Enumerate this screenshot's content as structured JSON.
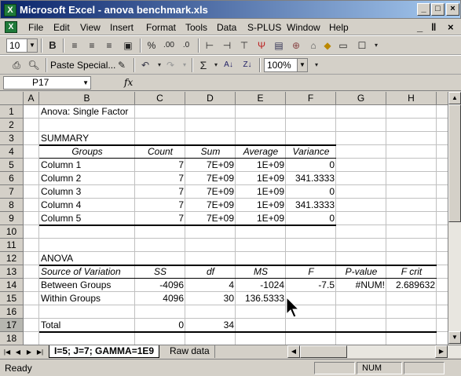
{
  "window": {
    "title": "Microsoft Excel - anova benchmark.xls",
    "minimize": "_",
    "maximize": "□",
    "close": "×"
  },
  "menu": {
    "items": [
      "File",
      "Edit",
      "View",
      "Insert",
      "Format",
      "Tools",
      "Data",
      "S-PLUS",
      "Window",
      "Help"
    ],
    "doc_controls": [
      "_",
      "ǁ",
      "×"
    ]
  },
  "toolbar1": {
    "font_size": "10",
    "bold": "B"
  },
  "toolbar2": {
    "paste_special": "Paste Special...",
    "zoom": "100%",
    "sigma": "Σ"
  },
  "formula_bar": {
    "name_box": "P17",
    "fx": "fx",
    "content": ""
  },
  "grid": {
    "columns": [
      "A",
      "B",
      "C",
      "D",
      "E",
      "F",
      "G",
      "H"
    ],
    "rows": [
      "1",
      "2",
      "3",
      "4",
      "5",
      "6",
      "7",
      "8",
      "9",
      "10",
      "11",
      "12",
      "13",
      "14",
      "15",
      "16",
      "17",
      "18"
    ],
    "selected_row": "17",
    "cells": {
      "B1": "Anova: Single Factor",
      "B3": "SUMMARY",
      "summary_headers": [
        "Groups",
        "Count",
        "Sum",
        "Average",
        "Variance"
      ],
      "summary_rows": [
        [
          "Column 1",
          "7",
          "7E+09",
          "1E+09",
          "0"
        ],
        [
          "Column 2",
          "7",
          "7E+09",
          "1E+09",
          "341.3333"
        ],
        [
          "Column 3",
          "7",
          "7E+09",
          "1E+09",
          "0"
        ],
        [
          "Column 4",
          "7",
          "7E+09",
          "1E+09",
          "341.3333"
        ],
        [
          "Column 5",
          "7",
          "7E+09",
          "1E+09",
          "0"
        ]
      ],
      "B12": "ANOVA",
      "anova_headers": [
        "Source of Variation",
        "SS",
        "df",
        "MS",
        "F",
        "P-value",
        "F crit"
      ],
      "anova_rows": [
        [
          "Between Groups",
          "-4096",
          "4",
          "-1024",
          "-7.5",
          "#NUM!",
          "2.689632"
        ],
        [
          "Within Groups",
          "4096",
          "30",
          "136.5333",
          "",
          "",
          ""
        ]
      ],
      "total_row": [
        "Total",
        "0",
        "34"
      ]
    }
  },
  "sheets": {
    "tabs": [
      "I=5; J=7; GAMMA=1E9",
      "Raw data"
    ],
    "active": "I=5; J=7; GAMMA=1E9"
  },
  "status": {
    "ready": "Ready",
    "num": "NUM"
  },
  "colors": {
    "title_bar": "#0a246a",
    "face": "#d4d0c8",
    "gridline": "#c0c0c0"
  }
}
